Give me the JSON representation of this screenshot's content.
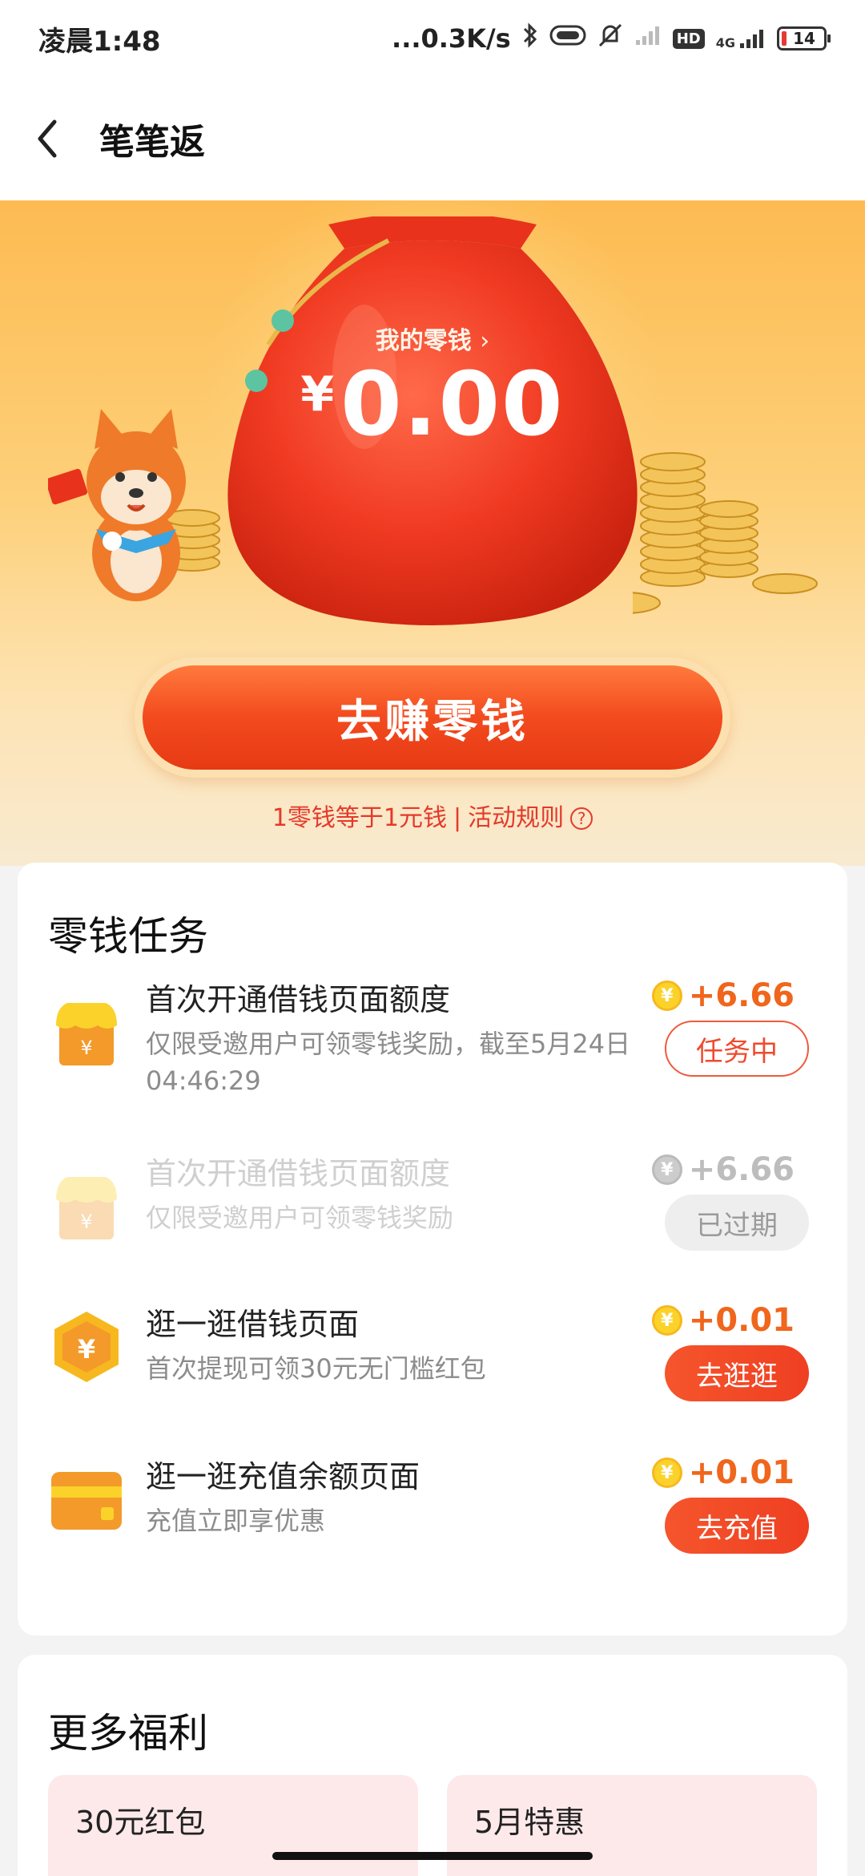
{
  "status_bar": {
    "time": "凌晨1:48",
    "network_speed": "...0.3K/s",
    "network_type": "4G",
    "hd_badge": "HD",
    "battery": "14"
  },
  "nav": {
    "title": "笔笔返"
  },
  "hero": {
    "wallet_label": "我的零钱",
    "currency_symbol": "¥",
    "amount": "0.00",
    "earn_button": "去赚零钱",
    "exchange_note": "1零钱等于1元钱",
    "separator": "|",
    "rules_link": "活动规则"
  },
  "tasks": {
    "title": "零钱任务",
    "items": [
      {
        "title": "首次开通借钱页面额度",
        "desc": "仅限受邀用户可领零钱奖励，截至5月24日04:46:29",
        "reward": "+6.66",
        "action": "任务中",
        "status": "in-progress"
      },
      {
        "title": "首次开通借钱页面额度",
        "desc": "仅限受邀用户可领零钱奖励",
        "reward": "+6.66",
        "action": "已过期",
        "status": "expired"
      },
      {
        "title": "逛一逛借钱页面",
        "desc": "首次提现可领30元无门槛红包",
        "reward": "+0.01",
        "action": "去逛逛",
        "status": "active"
      },
      {
        "title": "逛一逛充值余额页面",
        "desc": "充值立即享优惠",
        "reward": "+0.01",
        "action": "去充值",
        "status": "active"
      }
    ]
  },
  "more": {
    "title": "更多福利",
    "items": [
      {
        "label": "30元红包"
      },
      {
        "label": "5月特惠"
      }
    ]
  },
  "icons": {
    "coin": "¥",
    "colors": {
      "accent": "#f0661c",
      "primary_button": "#ef3f22",
      "link": "#e5392a"
    }
  }
}
